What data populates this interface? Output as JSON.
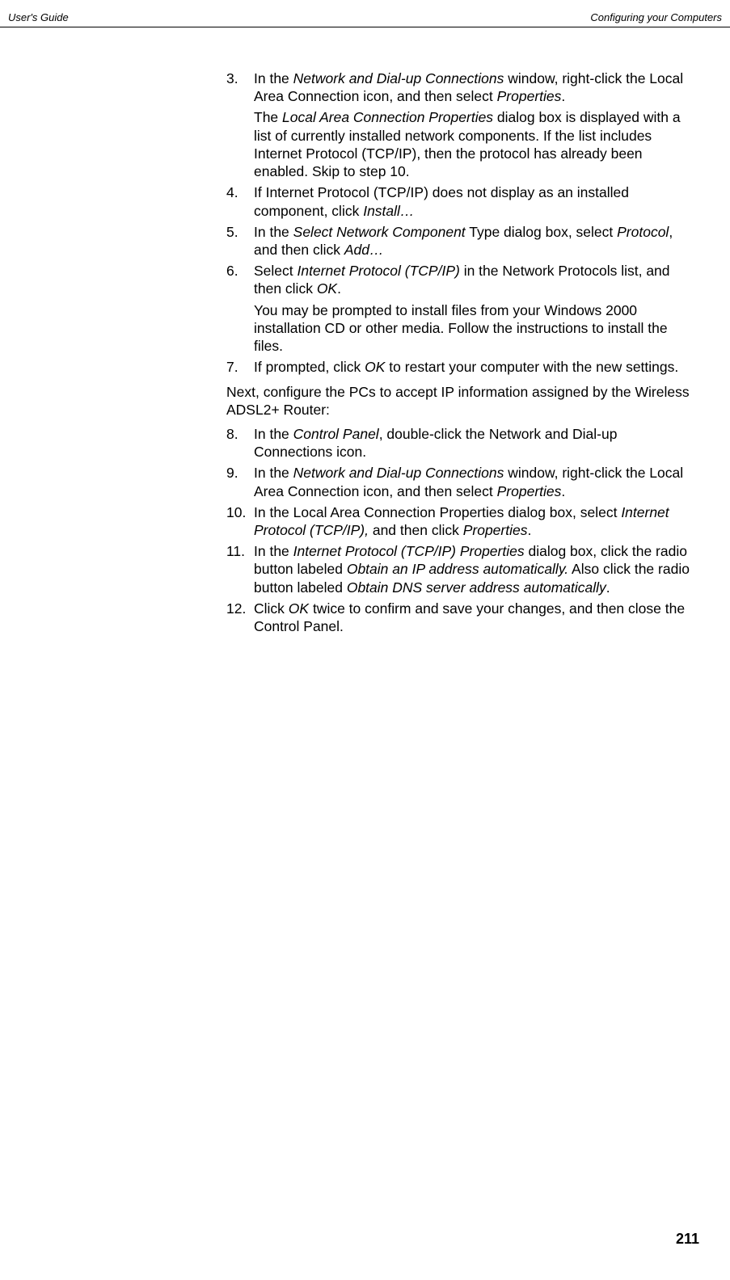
{
  "header": {
    "left": "User's Guide",
    "right": "Configuring your Computers"
  },
  "items": {
    "i3": {
      "num": "3.",
      "text_pre": "In the ",
      "em1": "Network and Dial-up Connections",
      "text_mid": " window, right-click the Local Area Connection icon, and then select ",
      "em2": "Properties",
      "text_end": "."
    },
    "i3b": {
      "text_pre": "The ",
      "em1": "Local Area Connection Properties",
      "text_end": " dialog box is displayed with a list of currently installed network components. If the list includes Internet Protocol (TCP/IP), then the protocol has already been enabled. Skip to step 10."
    },
    "i4": {
      "num": "4.",
      "text_pre": "If Internet Protocol (TCP/IP) does not display as an installed component, click ",
      "em1": "Install…"
    },
    "i5": {
      "num": "5.",
      "text_pre": "In the ",
      "em1": "Select Network Component",
      "text_mid": " Type dialog box, select ",
      "em2": "Protocol",
      "text_mid2": ", and then click ",
      "em3": "Add…"
    },
    "i6": {
      "num": "6.",
      "text_pre": "Select ",
      "em1": "Internet Protocol (TCP/IP)",
      "text_mid": " in the Network Protocols list, and then click ",
      "em2": "OK",
      "text_end": "."
    },
    "i6b": {
      "text": "You may be prompted to install files from your Windows 2000 installation CD or other media. Follow the instructions to install the files."
    },
    "i7": {
      "num": "7.",
      "text_pre": "If prompted, click ",
      "em1": "OK",
      "text_end": " to restart your computer with the new settings."
    },
    "para": {
      "text": "Next, configure the PCs to accept IP information assigned by the Wireless ADSL2+ Router:"
    },
    "i8": {
      "num": "8.",
      "text_pre": "In the ",
      "em1": "Control Panel",
      "text_end": ", double-click the Network and Dial-up Connections icon."
    },
    "i9": {
      "num": "9.",
      "text_pre": "In the ",
      "em1": "Network and Dial-up Connections",
      "text_mid": " window, right-click the Local Area Connection icon, and then select ",
      "em2": "Properties",
      "text_end": "."
    },
    "i10": {
      "num": "10.",
      "text_pre": "In the Local Area Connection Properties dialog box, select ",
      "em1": "Internet Protocol (TCP/IP),",
      "text_mid": " and then click ",
      "em2": "Properties",
      "text_end": "."
    },
    "i11": {
      "num": "11.",
      "text_pre": "In the ",
      "em1": "Internet Protocol (TCP/IP) Properties",
      "text_mid": " dialog box, click the radio button labeled ",
      "em2": "Obtain an IP address automatically.",
      "text_mid2": " Also click the radio button labeled ",
      "em3": "Obtain DNS server address automatically",
      "text_end": "."
    },
    "i12": {
      "num": "12.",
      "text_pre": "Click ",
      "em1": "OK",
      "text_end": " twice to confirm and save your changes, and then close the Control Panel."
    }
  },
  "pageNumber": "211"
}
